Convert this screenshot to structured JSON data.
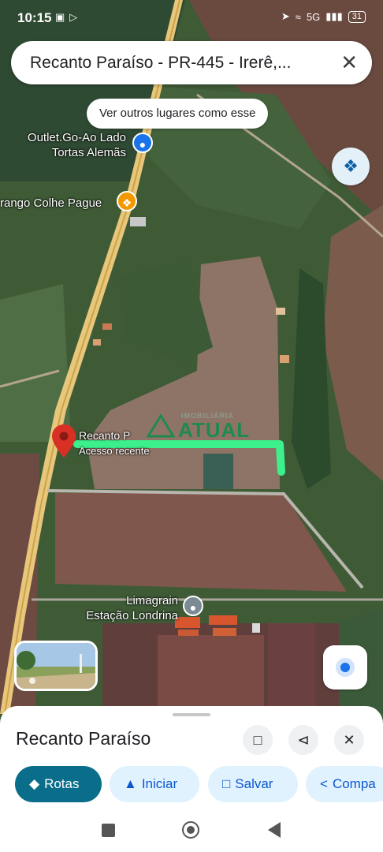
{
  "status_bar": {
    "time": "10:15",
    "battery": "31",
    "network": "5G"
  },
  "search": {
    "query": "Recanto Paraíso - PR-445 - Irerê,...",
    "close_icon": "close-icon"
  },
  "chip": {
    "label": "Ver outros lugares como esse"
  },
  "map_labels": {
    "outlet": "Outlet.Go-Ao Lado\nTortas Alemãs",
    "morango": "rango Colhe Pague",
    "recanto": "Recanto P",
    "recent": "Acesso recente",
    "limagrain_line1": "Limagrain",
    "limagrain_line2": "Estação Londrina",
    "watermark_top": "IMOBILIÁRIA",
    "watermark_main": "ATUAL"
  },
  "place": {
    "name": "Recanto Paraíso"
  },
  "actions": [
    {
      "label": "Rotas",
      "icon": "directions-icon"
    },
    {
      "label": "Iniciar",
      "icon": "navigation-icon"
    },
    {
      "label": "Salvar",
      "icon": "bookmark-icon"
    },
    {
      "label": "Compa",
      "icon": "share-icon"
    }
  ],
  "colors": {
    "accent": "#0b57d0",
    "route_highlight": "#3cf08c",
    "pin": "#d93025"
  }
}
